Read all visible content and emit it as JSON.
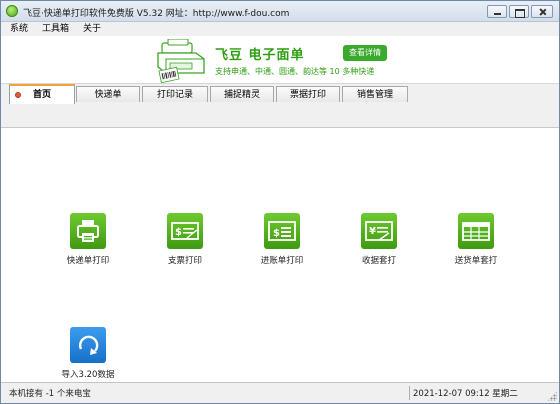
{
  "window": {
    "title": "飞豆·快递单打印软件免费版 V5.32 网址：http://www.f-dou.com"
  },
  "menu": [
    {
      "label": "系统"
    },
    {
      "label": "工具箱"
    },
    {
      "label": "关于"
    }
  ],
  "banner": {
    "title": "飞豆  电子面单",
    "subtitle": "支持申通、中通、圆通、韵达等 10 多种快递",
    "detail_button": "查看详情",
    "accent_color": "#2e9e0f"
  },
  "tabs": [
    {
      "label": "首页",
      "active": true
    },
    {
      "label": "快递单",
      "active": false
    },
    {
      "label": "打印记录",
      "active": false
    },
    {
      "label": "捕捉精灵",
      "active": false
    },
    {
      "label": "票据打印",
      "active": false
    },
    {
      "label": "销售管理",
      "active": false
    }
  ],
  "functions": [
    {
      "label": "快递单打印",
      "icon": "printer-icon",
      "color": "#4aa81c"
    },
    {
      "label": "支票打印",
      "icon": "check-money-icon",
      "color": "#4aa81c"
    },
    {
      "label": "进账单打印",
      "icon": "deposit-slip-icon",
      "color": "#4aa81c"
    },
    {
      "label": "收据套打",
      "icon": "receipt-yen-icon",
      "color": "#4aa81c"
    },
    {
      "label": "送货单套打",
      "icon": "delivery-sheet-icon",
      "color": "#4aa81c"
    },
    {
      "label": "导入3.20数据",
      "icon": "import-refresh-icon",
      "color": "#1f7fde"
    }
  ],
  "status": {
    "left": "本机接有 -1 个来电宝",
    "right": "2021-12-07 09:12 星期二"
  }
}
